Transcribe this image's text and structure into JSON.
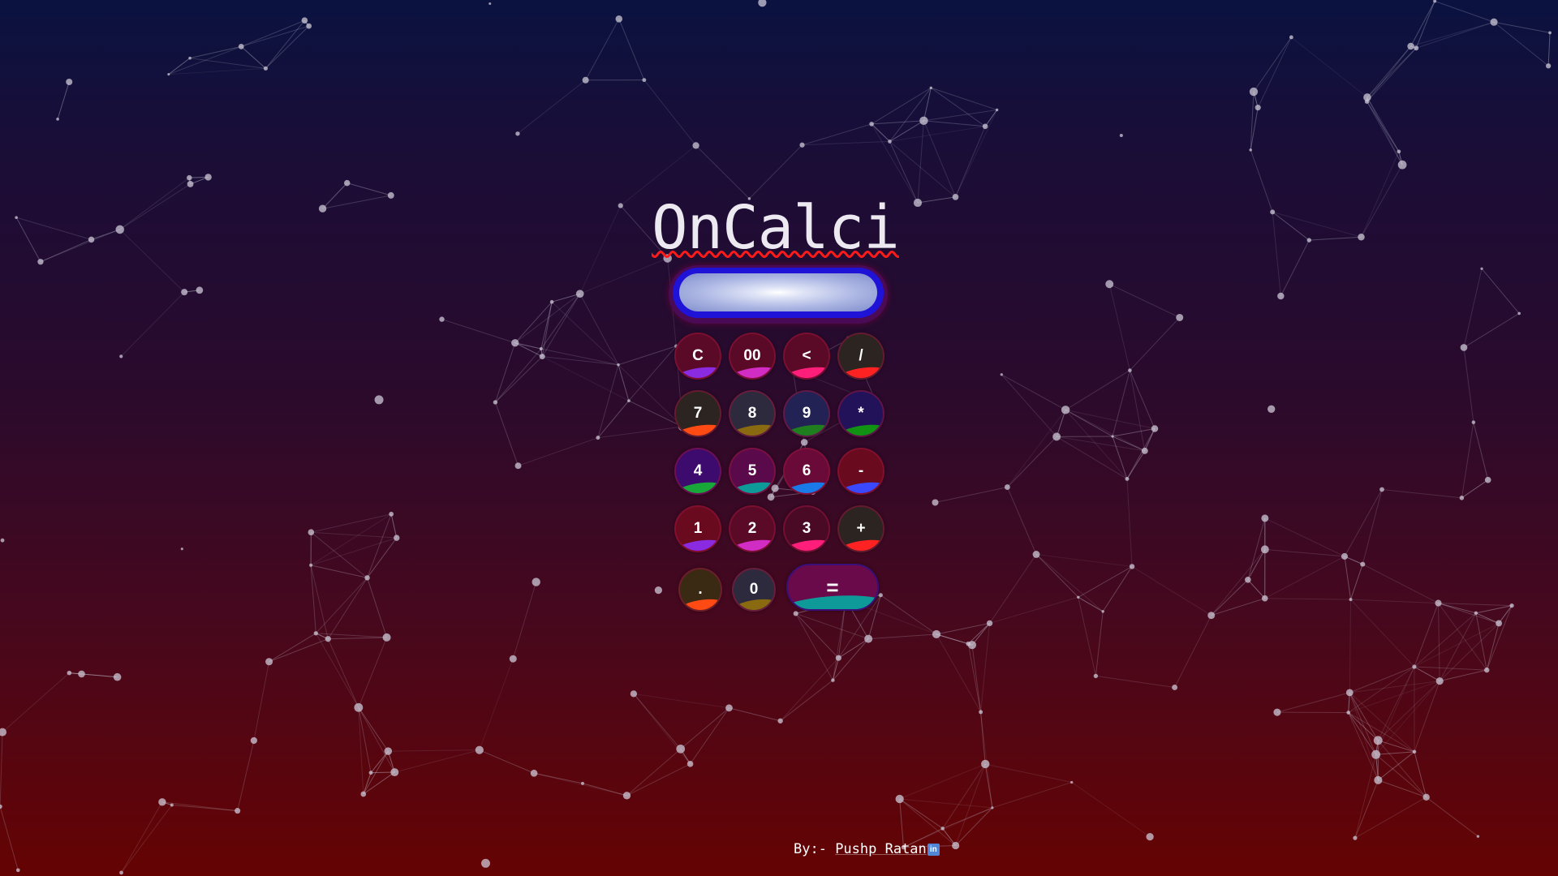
{
  "app": {
    "title": "OnCalci"
  },
  "display": {
    "value": ""
  },
  "keys": [
    {
      "label": "C",
      "name": "clear-button",
      "bg": "#5a0a26",
      "wave": "#8a2be2"
    },
    {
      "label": "00",
      "name": "double-zero-button",
      "bg": "#5a0a26",
      "wave": "#d12cc4"
    },
    {
      "label": "<",
      "name": "backspace-button",
      "bg": "#5a0a26",
      "wave": "#ff1f7a"
    },
    {
      "label": "/",
      "name": "divide-button",
      "bg": "#2b2420",
      "wave": "#ff2222"
    },
    {
      "label": "7",
      "name": "seven-button",
      "bg": "#2b2420",
      "wave": "#ff4a14"
    },
    {
      "label": "8",
      "name": "eight-button",
      "bg": "#2e2a3d",
      "wave": "#8a6a10"
    },
    {
      "label": "9",
      "name": "nine-button",
      "bg": "#222255",
      "wave": "#1f7f1f"
    },
    {
      "label": "*",
      "name": "multiply-button",
      "bg": "#22125a",
      "wave": "#129212"
    },
    {
      "label": "4",
      "name": "four-button",
      "bg": "#3d0b6e",
      "wave": "#18a83a"
    },
    {
      "label": "5",
      "name": "five-button",
      "bg": "#5a0a4a",
      "wave": "#0f9a9a"
    },
    {
      "label": "6",
      "name": "six-button",
      "bg": "#6a0a38",
      "wave": "#1a7ae8"
    },
    {
      "label": "-",
      "name": "subtract-button",
      "bg": "#6a0a1e",
      "wave": "#3a48ff"
    },
    {
      "label": "1",
      "name": "one-button",
      "bg": "#6a0a1e",
      "wave": "#8a2be2"
    },
    {
      "label": "2",
      "name": "two-button",
      "bg": "#5a0a26",
      "wave": "#d12cc4"
    },
    {
      "label": "3",
      "name": "three-button",
      "bg": "#4a0a26",
      "wave": "#ff1f7a"
    },
    {
      "label": "+",
      "name": "add-button",
      "bg": "#2b2420",
      "wave": "#ff2222"
    },
    {
      "label": ".",
      "name": "decimal-button",
      "bg": "#3a2a14",
      "wave": "#ff4a14"
    },
    {
      "label": "0",
      "name": "zero-button",
      "bg": "#2e2a3d",
      "wave": "#8a6a10"
    },
    {
      "label": "=",
      "name": "equals-button",
      "bg": "#6a0a4a",
      "wave": "#0f9a9a"
    }
  ],
  "footer": {
    "prefix": "By:- ",
    "author": "Pushp Ratan",
    "link_icon": "linkedin-icon",
    "link_icon_text": "in"
  },
  "colors": {
    "title_underline": "#ff1a1a",
    "display_border": "#1e13d6",
    "background_top": "#0b1240",
    "background_bottom": "#650303"
  }
}
